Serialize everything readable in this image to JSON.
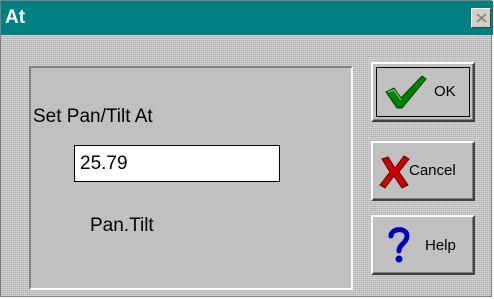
{
  "window": {
    "title": "At"
  },
  "panel": {
    "label": "Set Pan/Tilt At",
    "value": "25.79",
    "sub_label": "Pan.Tilt"
  },
  "buttons": {
    "ok": "OK",
    "cancel": "Cancel",
    "help": "Help"
  },
  "colors": {
    "titlebar": "#008080",
    "check_green": "#008000",
    "cancel_red": "#cc0000",
    "help_blue": "#0000c0"
  }
}
